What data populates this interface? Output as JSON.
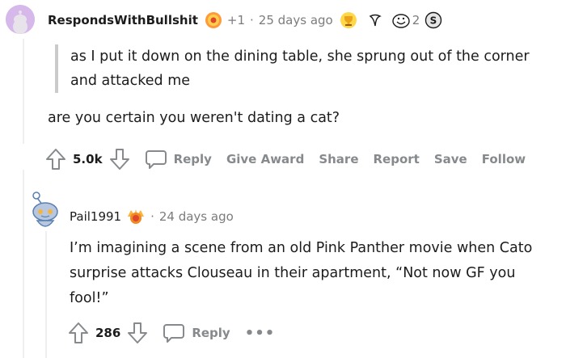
{
  "comment1": {
    "username": "RespondsWithBullshit",
    "karma_badge": "+1",
    "separator": "·",
    "age": "25 days ago",
    "award_count": "2",
    "quote_lines": [
      "as I put it down on the dining table, she sprung out of the corner",
      "and attacked me"
    ],
    "body": "are you certain you weren't dating a cat?",
    "votes": "5.0k",
    "actions": {
      "reply": "Reply",
      "give_award": "Give Award",
      "share": "Share",
      "report": "Report",
      "save": "Save",
      "follow": "Follow"
    }
  },
  "comment2": {
    "username": "Pail1991",
    "separator": "·",
    "age": "24 days ago",
    "body_lines": [
      "I’m imagining a scene from an old Pink Panther movie when Cato",
      "surprise attacks Clouseau in their apartment, “Not now GF you",
      "fool!”"
    ],
    "votes": "286",
    "actions": {
      "reply": "Reply",
      "more": "•••"
    }
  },
  "colors": {
    "meta_gray": "#7c7c7c",
    "action_gray": "#878a8c",
    "text": "#1c1c1c",
    "thread_line": "#edeff1"
  }
}
